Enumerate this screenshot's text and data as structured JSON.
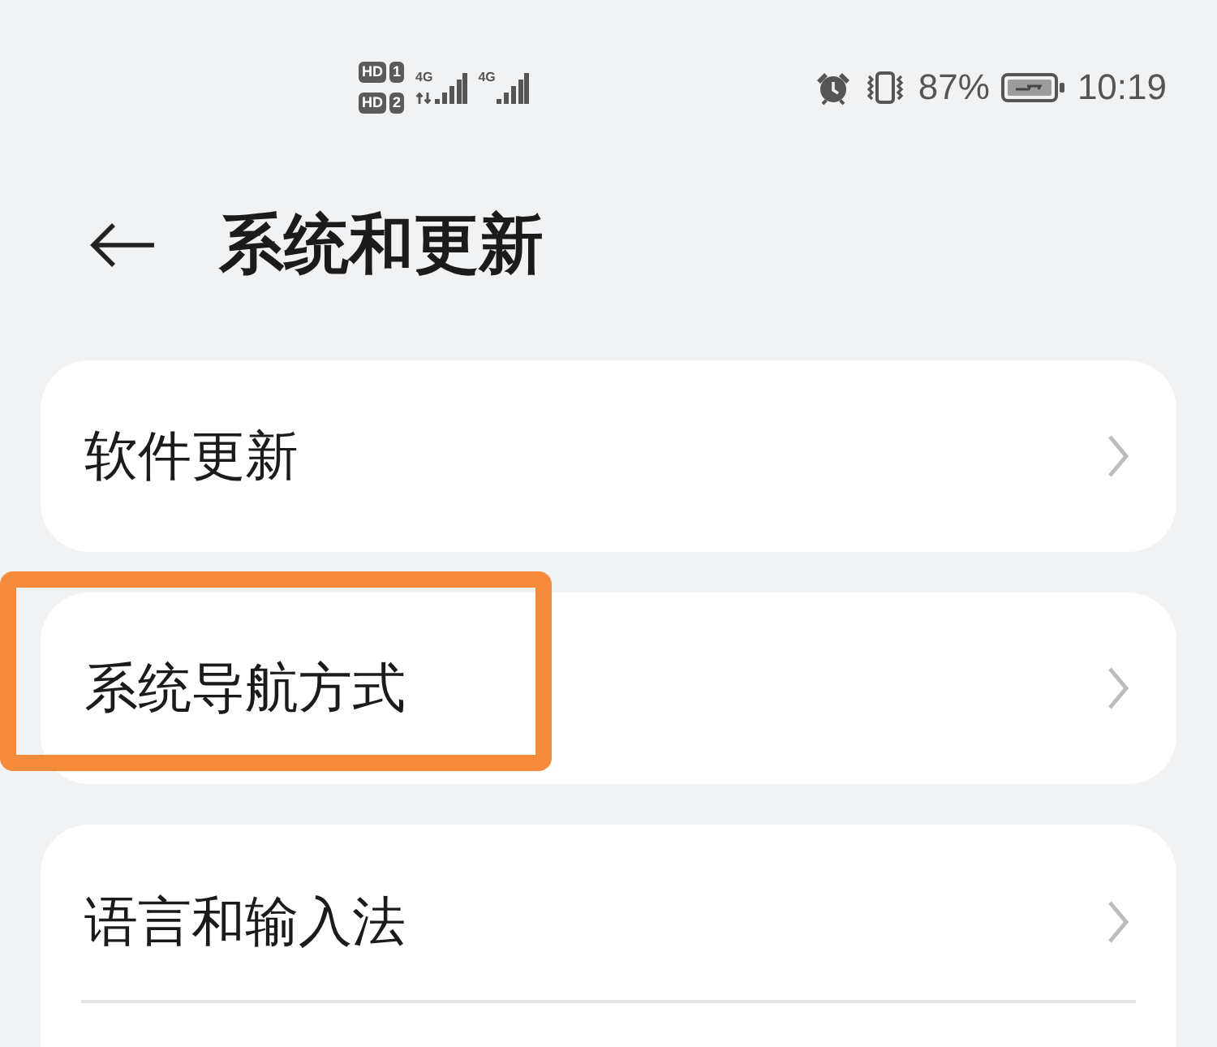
{
  "status_bar": {
    "sim_badges": [
      {
        "label": "HD",
        "number": "1"
      },
      {
        "label": "HD",
        "number": "2"
      }
    ],
    "signals": [
      {
        "network": "4G",
        "data_activity": true
      },
      {
        "network": "4G",
        "data_activity": false
      }
    ],
    "battery": "87%",
    "time": "10:19"
  },
  "header": {
    "title": "系统和更新"
  },
  "groups": [
    {
      "items": [
        {
          "label": "软件更新",
          "highlighted": false,
          "divider_below": false
        }
      ]
    },
    {
      "items": [
        {
          "label": "系统导航方式",
          "highlighted": true,
          "divider_below": false
        }
      ]
    },
    {
      "items": [
        {
          "label": "语言和输入法",
          "highlighted": false,
          "divider_below": true
        }
      ]
    }
  ]
}
